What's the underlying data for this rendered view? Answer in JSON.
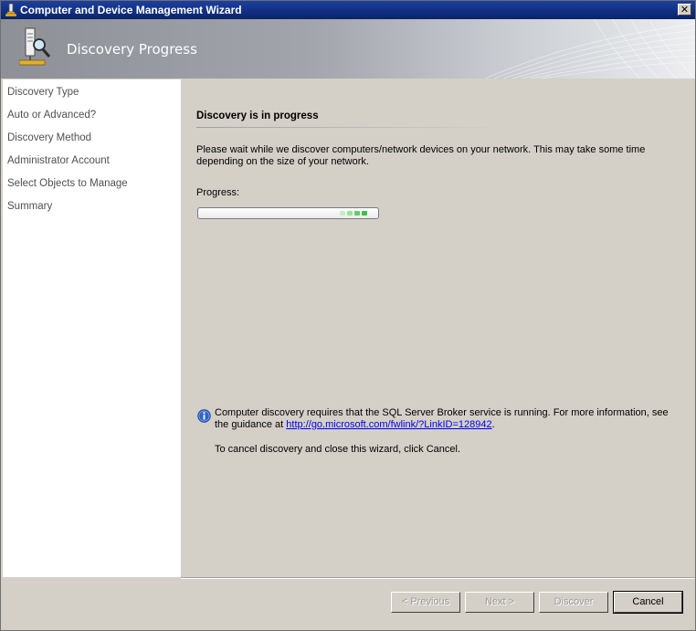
{
  "window": {
    "title": "Computer and Device Management Wizard",
    "close_glyph": "✕"
  },
  "header": {
    "title": "Discovery Progress",
    "icon": "wizard-discovery-icon"
  },
  "nav": {
    "items": [
      {
        "label": "Discovery Type"
      },
      {
        "label": "Auto or Advanced?"
      },
      {
        "label": "Discovery Method"
      },
      {
        "label": "Administrator Account"
      },
      {
        "label": "Select Objects to Manage"
      },
      {
        "label": "Summary"
      }
    ]
  },
  "main": {
    "section_title": "Discovery is in progress",
    "description": "Please wait while we discover computers/network devices on your network. This may take some time depending on the size of your network.",
    "progress_label": "Progress:",
    "progress": {
      "style": "marquee",
      "color": "#3cc24a"
    },
    "info": {
      "icon": "info-icon",
      "text_before": "Computer discovery requires that the SQL Server Broker service is running. For more information, see the guidance at ",
      "link": "http://go.microsoft.com/fwlink/?LinkID=128942",
      "text_after": "."
    },
    "cancel_note": "To cancel discovery and close this wizard, click Cancel."
  },
  "footer": {
    "previous": "< Previous",
    "next": "Next >",
    "discover": "Discover",
    "cancel": "Cancel"
  }
}
